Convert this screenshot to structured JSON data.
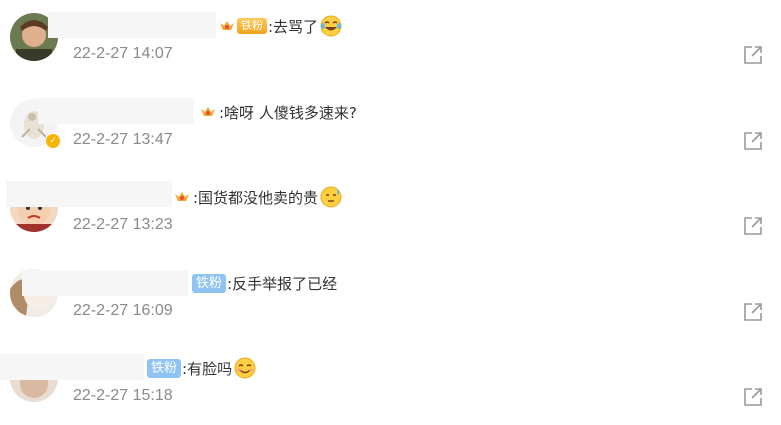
{
  "comments": [
    {
      "badge": "铁粉",
      "text": ":去骂了",
      "time": "22-2-27 14:07",
      "emoji": "laugh-cry-emoji"
    },
    {
      "badge": "",
      "text": ":啥呀 人傻钱多速来?",
      "time": "22-2-27 13:47",
      "emoji": ""
    },
    {
      "badge": "",
      "text": ":国货都没他卖的贵",
      "time": "22-2-27 13:23",
      "emoji": "sweat-emoji"
    },
    {
      "badge": "铁粉",
      "text": ":反手举报了已经",
      "time": "22-2-27 16:09",
      "emoji": ""
    },
    {
      "badge": "铁粉",
      "text": ":有脸吗",
      "time": "22-2-27 15:18",
      "emoji": "smile-emoji"
    }
  ],
  "colors": {
    "text": "#333333",
    "time": "#8a8a8a",
    "badge_blue": "#8fc3f3",
    "badge_gold": "#f3a21b",
    "icon": "#999999"
  },
  "icons": {
    "share": "share-external-icon",
    "crown": "crown-icon",
    "verified": "verified-icon"
  }
}
